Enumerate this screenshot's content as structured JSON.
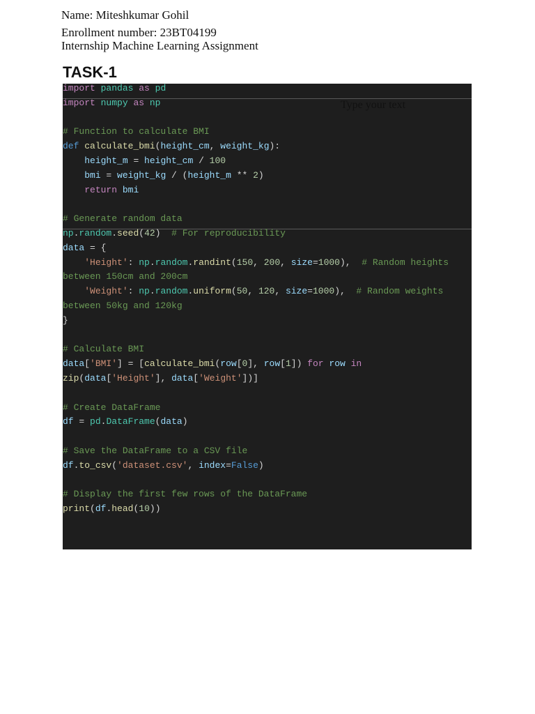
{
  "header": {
    "name": "Name: Miteshkumar Gohil",
    "enrollment": "Enrollment number: 23BT04199",
    "course": "Internship Machine Learning Assignment"
  },
  "task_title": "TASK-1",
  "placeholder_text": "Type your text",
  "code_lines": [
    [
      [
        "import",
        "k"
      ],
      [
        " ",
        "p"
      ],
      [
        "pandas",
        "m"
      ],
      [
        " ",
        "p"
      ],
      [
        "as",
        "k"
      ],
      [
        " ",
        "p"
      ],
      [
        "pd",
        "m"
      ]
    ],
    [
      [
        "import",
        "k"
      ],
      [
        " ",
        "p"
      ],
      [
        "numpy",
        "m"
      ],
      [
        " ",
        "p"
      ],
      [
        "as",
        "k"
      ],
      [
        " ",
        "p"
      ],
      [
        "np",
        "m"
      ]
    ],
    [],
    [
      [
        "# Function to calculate BMI",
        "c"
      ]
    ],
    [
      [
        "def",
        "d"
      ],
      [
        " ",
        "p"
      ],
      [
        "calculate_bmi",
        "f"
      ],
      [
        "(",
        "p"
      ],
      [
        "height_cm",
        "v"
      ],
      [
        ", ",
        "p"
      ],
      [
        "weight_kg",
        "v"
      ],
      [
        "):",
        "p"
      ]
    ],
    [
      [
        "    ",
        "p"
      ],
      [
        "height_m",
        "v"
      ],
      [
        " = ",
        "p"
      ],
      [
        "height_cm",
        "v"
      ],
      [
        " / ",
        "p"
      ],
      [
        "100",
        "n"
      ]
    ],
    [
      [
        "    ",
        "p"
      ],
      [
        "bmi",
        "v"
      ],
      [
        " = ",
        "p"
      ],
      [
        "weight_kg",
        "v"
      ],
      [
        " / (",
        "p"
      ],
      [
        "height_m",
        "v"
      ],
      [
        " ** ",
        "p"
      ],
      [
        "2",
        "n"
      ],
      [
        ")",
        "p"
      ]
    ],
    [
      [
        "    ",
        "p"
      ],
      [
        "return",
        "k"
      ],
      [
        " ",
        "p"
      ],
      [
        "bmi",
        "v"
      ]
    ],
    [],
    [
      [
        "# Generate random data",
        "c"
      ]
    ],
    [
      [
        "np",
        "m"
      ],
      [
        ".",
        "p"
      ],
      [
        "random",
        "m"
      ],
      [
        ".",
        "p"
      ],
      [
        "seed",
        "f"
      ],
      [
        "(",
        "p"
      ],
      [
        "42",
        "n"
      ],
      [
        ")  ",
        "p"
      ],
      [
        "# For reproducibility",
        "c"
      ]
    ],
    [
      [
        "data",
        "v"
      ],
      [
        " = {",
        "p"
      ]
    ],
    [
      [
        "    ",
        "p"
      ],
      [
        "'Height'",
        "s"
      ],
      [
        ": ",
        "p"
      ],
      [
        "np",
        "m"
      ],
      [
        ".",
        "p"
      ],
      [
        "random",
        "m"
      ],
      [
        ".",
        "p"
      ],
      [
        "randint",
        "f"
      ],
      [
        "(",
        "p"
      ],
      [
        "150",
        "n"
      ],
      [
        ", ",
        "p"
      ],
      [
        "200",
        "n"
      ],
      [
        ", ",
        "p"
      ],
      [
        "size",
        "v"
      ],
      [
        "=",
        "p"
      ],
      [
        "1000",
        "n"
      ],
      [
        "),  ",
        "p"
      ],
      [
        "# Random heights",
        "c"
      ]
    ],
    [
      [
        "between 150cm and 200cm",
        "c"
      ]
    ],
    [
      [
        "    ",
        "p"
      ],
      [
        "'Weight'",
        "s"
      ],
      [
        ": ",
        "p"
      ],
      [
        "np",
        "m"
      ],
      [
        ".",
        "p"
      ],
      [
        "random",
        "m"
      ],
      [
        ".",
        "p"
      ],
      [
        "uniform",
        "f"
      ],
      [
        "(",
        "p"
      ],
      [
        "50",
        "n"
      ],
      [
        ", ",
        "p"
      ],
      [
        "120",
        "n"
      ],
      [
        ", ",
        "p"
      ],
      [
        "size",
        "v"
      ],
      [
        "=",
        "p"
      ],
      [
        "1000",
        "n"
      ],
      [
        "),  ",
        "p"
      ],
      [
        "# Random weights",
        "c"
      ]
    ],
    [
      [
        "between 50kg and 120kg",
        "c"
      ]
    ],
    [
      [
        "}",
        "p"
      ]
    ],
    [],
    [
      [
        "# Calculate BMI",
        "c"
      ]
    ],
    [
      [
        "data",
        "v"
      ],
      [
        "[",
        "p"
      ],
      [
        "'BMI'",
        "s"
      ],
      [
        "] = [",
        "p"
      ],
      [
        "calculate_bmi",
        "f"
      ],
      [
        "(",
        "p"
      ],
      [
        "row",
        "v"
      ],
      [
        "[",
        "p"
      ],
      [
        "0",
        "n"
      ],
      [
        "], ",
        "p"
      ],
      [
        "row",
        "v"
      ],
      [
        "[",
        "p"
      ],
      [
        "1",
        "n"
      ],
      [
        "]) ",
        "p"
      ],
      [
        "for",
        "k"
      ],
      [
        " ",
        "p"
      ],
      [
        "row",
        "v"
      ],
      [
        " ",
        "p"
      ],
      [
        "in",
        "k"
      ]
    ],
    [
      [
        "zip",
        "f"
      ],
      [
        "(",
        "p"
      ],
      [
        "data",
        "v"
      ],
      [
        "[",
        "p"
      ],
      [
        "'Height'",
        "s"
      ],
      [
        "], ",
        "p"
      ],
      [
        "data",
        "v"
      ],
      [
        "[",
        "p"
      ],
      [
        "'Weight'",
        "s"
      ],
      [
        "])]",
        "p"
      ]
    ],
    [],
    [
      [
        "# Create DataFrame",
        "c"
      ]
    ],
    [
      [
        "df",
        "v"
      ],
      [
        " = ",
        "p"
      ],
      [
        "pd",
        "m"
      ],
      [
        ".",
        "p"
      ],
      [
        "DataFrame",
        "m"
      ],
      [
        "(",
        "p"
      ],
      [
        "data",
        "v"
      ],
      [
        ")",
        "p"
      ]
    ],
    [],
    [
      [
        "# Save the DataFrame to a CSV file",
        "c"
      ]
    ],
    [
      [
        "df",
        "v"
      ],
      [
        ".",
        "p"
      ],
      [
        "to_csv",
        "f"
      ],
      [
        "(",
        "p"
      ],
      [
        "'dataset.csv'",
        "s"
      ],
      [
        ", ",
        "p"
      ],
      [
        "index",
        "v"
      ],
      [
        "=",
        "p"
      ],
      [
        "False",
        "d"
      ],
      [
        ")",
        "p"
      ]
    ],
    [],
    [
      [
        "# Display the first few rows of the DataFrame",
        "c"
      ]
    ],
    [
      [
        "print",
        "f"
      ],
      [
        "(",
        "p"
      ],
      [
        "df",
        "v"
      ],
      [
        ".",
        "p"
      ],
      [
        "head",
        "f"
      ],
      [
        "(",
        "p"
      ],
      [
        "10",
        "n"
      ],
      [
        "))",
        "p"
      ]
    ]
  ]
}
